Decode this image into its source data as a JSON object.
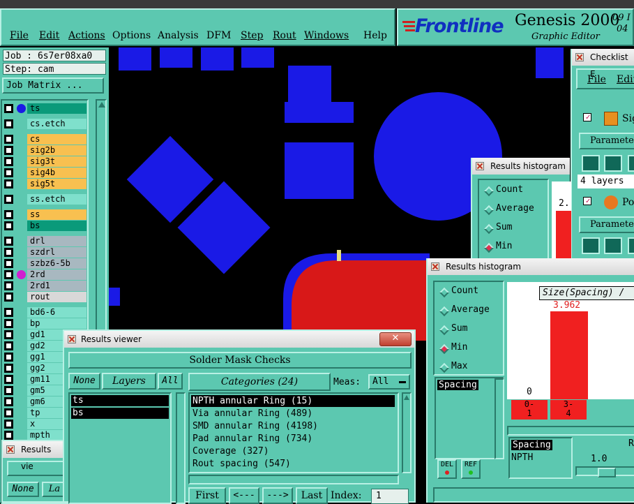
{
  "menubar": {
    "items": [
      {
        "label": "File"
      },
      {
        "label": "Edit"
      },
      {
        "label": "Actions"
      },
      {
        "label": "Options"
      },
      {
        "label": "Analysis"
      },
      {
        "label": "DFM"
      },
      {
        "label": "Step"
      },
      {
        "label": "Rout"
      },
      {
        "label": "Windows"
      },
      {
        "label": "Help"
      }
    ]
  },
  "brand": {
    "logo": "Frontline",
    "product": "Genesis 2000",
    "subtitle": "Graphic Editor",
    "date_top": "09 I",
    "date_bottom": "04"
  },
  "job": {
    "job_label": "Job : 6s7er08xa0",
    "step_label": "Step: cam",
    "matrix_button": "Job Matrix ..."
  },
  "layers": [
    {
      "name": "ts",
      "color": "#0a9a7a"
    },
    {
      "name": "cs.etch",
      "color": "#7fe0cc"
    },
    {
      "name": "cs",
      "color": "#f8c050"
    },
    {
      "name": "sig2b",
      "color": "#f8c050"
    },
    {
      "name": "sig3t",
      "color": "#f8c050"
    },
    {
      "name": "sig4b",
      "color": "#f8c050"
    },
    {
      "name": "sig5t",
      "color": "#f8c050"
    },
    {
      "name": "ss.etch",
      "color": "#7fe0cc"
    },
    {
      "name": "ss",
      "color": "#f8c050"
    },
    {
      "name": "bs",
      "color": "#0a9a7a"
    },
    {
      "name": "drl",
      "color": "#a8b8c0"
    },
    {
      "name": "szdrl",
      "color": "#a8b8c0"
    },
    {
      "name": "szbz6-5b",
      "color": "#a8b8c0"
    },
    {
      "name": "2rd",
      "color": "#a8b8c0"
    },
    {
      "name": "2rd1",
      "color": "#a8b8c0"
    },
    {
      "name": "rout",
      "color": "#d8d8d8"
    },
    {
      "name": "bd6-6",
      "color": "#7fe0cc"
    },
    {
      "name": "bp",
      "color": "#7fe0cc"
    },
    {
      "name": "gd1",
      "color": "#7fe0cc"
    },
    {
      "name": "gd2",
      "color": "#7fe0cc"
    },
    {
      "name": "gg1",
      "color": "#7fe0cc"
    },
    {
      "name": "gg2",
      "color": "#7fe0cc"
    },
    {
      "name": "gm11",
      "color": "#7fe0cc"
    },
    {
      "name": "gm5",
      "color": "#7fe0cc"
    },
    {
      "name": "gm6",
      "color": "#7fe0cc"
    },
    {
      "name": "tp",
      "color": "#7fe0cc"
    },
    {
      "name": "x",
      "color": "#7fe0cc"
    },
    {
      "name": "mpth",
      "color": "#7fe0cc"
    }
  ],
  "checklist": {
    "title": "Checklist E",
    "menu_file": "File",
    "menu_edit": "Edit",
    "row1_label": "Sig",
    "param1": "Parameter",
    "layers_value": "4 layers",
    "row2_label": "Pov",
    "param2": "Parameter"
  },
  "histogram_back": {
    "title": "Results histogram",
    "options": [
      "Count",
      "Average",
      "Sum",
      "Min"
    ],
    "selected": "Min",
    "bar_label": "2."
  },
  "histogram_front": {
    "title": "Results histogram",
    "options": [
      "Count",
      "Average",
      "Sum",
      "Min",
      "Max"
    ],
    "selected": "Min",
    "chart_title": "Size(Spacing) /",
    "bar_value": "3.962",
    "zero_label": "0",
    "bins": [
      {
        "top": "0-",
        "bottom": "1"
      },
      {
        "top": "3-",
        "bottom": "4"
      }
    ],
    "list_item": "Spacing",
    "del_button": "DEL",
    "ref_button": "REF",
    "table_header": "Spacing",
    "table_row": "NPTH",
    "right_header": "R",
    "slider_value": "1.0"
  },
  "results_viewer": {
    "title": "Results viewer",
    "header": "Solder Mask Checks",
    "none_button": "None",
    "layers_button": "Layers",
    "all_button": "All",
    "layers_list": [
      "ts",
      "bs"
    ],
    "categories_button": "Categories (24)",
    "meas_label": "Meas:",
    "meas_value": "All",
    "categories": [
      "NPTH annular Ring (15)",
      "Via annular Ring (489)",
      "SMD annular Ring (4198)",
      "Pad annular Ring (734)",
      "Coverage (327)",
      "Rout spacing (547)"
    ],
    "first_button": "First",
    "prev_button": "<---",
    "next_button": "--->",
    "last_button": "Last",
    "index_label": "Index:",
    "index_value": "1"
  },
  "results_viewer_back": {
    "title": "Results vie",
    "none_button": "None",
    "layers_button": "La"
  }
}
